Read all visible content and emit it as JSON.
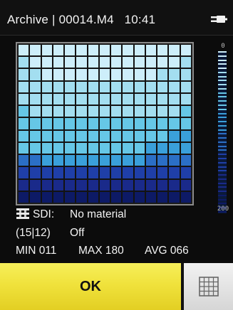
{
  "status": {
    "mode": "Archive",
    "separator": "|",
    "file": "00014.M4",
    "time": "10:41",
    "icon": "plug-icon"
  },
  "heatmap": {
    "cols": 15,
    "rows": 13,
    "palette": [
      "#0d1a66",
      "#1a2a8a",
      "#1f3fa8",
      "#2b6fc6",
      "#3aa0da",
      "#66c7e6",
      "#a3def0",
      "#cdeefa"
    ],
    "levels": [
      [
        7,
        7,
        7,
        7,
        7,
        7,
        7,
        7,
        7,
        7,
        7,
        7,
        7,
        7,
        7
      ],
      [
        6,
        7,
        7,
        7,
        7,
        7,
        7,
        7,
        7,
        7,
        7,
        7,
        7,
        7,
        6
      ],
      [
        6,
        6,
        7,
        7,
        7,
        7,
        7,
        7,
        7,
        7,
        7,
        7,
        6,
        6,
        6
      ],
      [
        6,
        6,
        6,
        6,
        6,
        6,
        6,
        6,
        6,
        6,
        6,
        6,
        6,
        6,
        6
      ],
      [
        6,
        6,
        6,
        6,
        6,
        6,
        6,
        6,
        6,
        6,
        6,
        6,
        6,
        6,
        6
      ],
      [
        5,
        6,
        6,
        6,
        6,
        6,
        6,
        6,
        6,
        6,
        6,
        6,
        6,
        6,
        5
      ],
      [
        5,
        5,
        5,
        5,
        5,
        5,
        5,
        5,
        5,
        5,
        5,
        5,
        5,
        5,
        5
      ],
      [
        5,
        5,
        5,
        5,
        5,
        5,
        5,
        5,
        5,
        5,
        5,
        5,
        5,
        4,
        4
      ],
      [
        5,
        5,
        5,
        5,
        5,
        5,
        5,
        5,
        5,
        5,
        5,
        4,
        4,
        4,
        4
      ],
      [
        3,
        3,
        4,
        4,
        4,
        4,
        4,
        4,
        4,
        4,
        4,
        3,
        3,
        3,
        3
      ],
      [
        2,
        2,
        2,
        2,
        2,
        2,
        2,
        2,
        2,
        2,
        2,
        2,
        2,
        2,
        2
      ],
      [
        1,
        1,
        1,
        1,
        1,
        1,
        1,
        1,
        1,
        1,
        1,
        1,
        1,
        1,
        1
      ],
      [
        0,
        0,
        0,
        0,
        0,
        0,
        0,
        0,
        0,
        0,
        0,
        0,
        0,
        0,
        0
      ]
    ]
  },
  "scale": {
    "top_label": "0",
    "bottom_label": "200"
  },
  "info": {
    "sdi_label": "SDI:",
    "sdi_value": "No material",
    "position": "(15|12)",
    "position_value": "Off",
    "min": "MIN 011",
    "max": "MAX 180",
    "avg": "AVG 066",
    "sdi_icon": "sdi-icon"
  },
  "buttons": {
    "ok_label": "OK",
    "grid_icon": "grid-icon"
  }
}
